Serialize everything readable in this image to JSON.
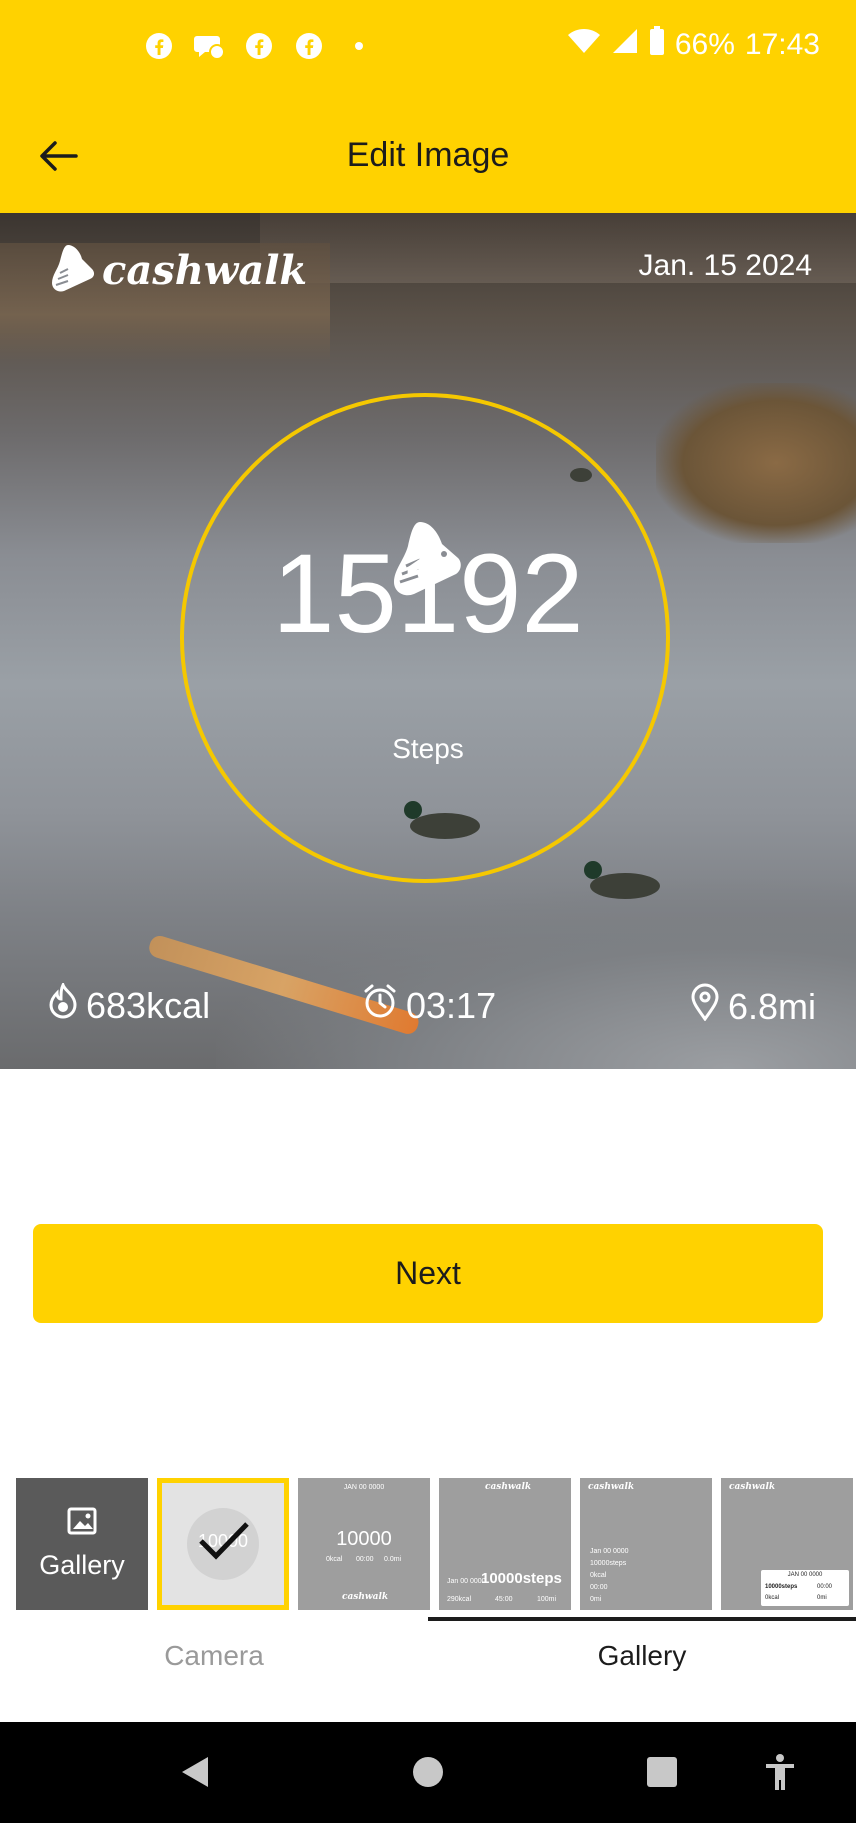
{
  "status_bar": {
    "battery": "66%",
    "time": "17:43",
    "notification_icons": [
      "facebook-icon",
      "messenger-icon",
      "facebook-icon",
      "facebook-icon",
      "dot-icon"
    ]
  },
  "app_bar": {
    "title": "Edit Image"
  },
  "photo_overlay": {
    "logo": "cashwalk",
    "date": "Jan. 15 2024",
    "steps_value": "15192",
    "steps_label": "Steps",
    "calories": "683kcal",
    "duration": "03:17",
    "distance": "6.8mi"
  },
  "next_button": {
    "label": "Next"
  },
  "templates": {
    "gallery_label": "Gallery",
    "selected_value": "10000",
    "t2": {
      "date": "JAN 00 0000",
      "steps": "10000",
      "kcal": "0kcal",
      "time": "00:00",
      "dist": "0.0mi",
      "logo": "cashwalk"
    },
    "t3": {
      "logo": "cashwalk",
      "date": "Jan 00 0000",
      "steps": "10000steps",
      "kcal": "290kcal",
      "time": "45:00",
      "dist": "100mi"
    },
    "t4": {
      "logo": "cashwalk",
      "date": "Jan 00 0000",
      "steps": "10000steps",
      "kcal": "0kcal",
      "time": "00:00",
      "dist": "0mi"
    },
    "t5": {
      "logo": "cashwalk",
      "date": "JAN 00 0000",
      "steps": "10000steps",
      "time": "00:00",
      "kcal": "0kcal",
      "dist": "0mi"
    }
  },
  "tabs": {
    "camera": "Camera",
    "gallery": "Gallery",
    "active": "Gallery"
  },
  "colors": {
    "accent": "#ffd200",
    "ring": "#f5c800"
  }
}
